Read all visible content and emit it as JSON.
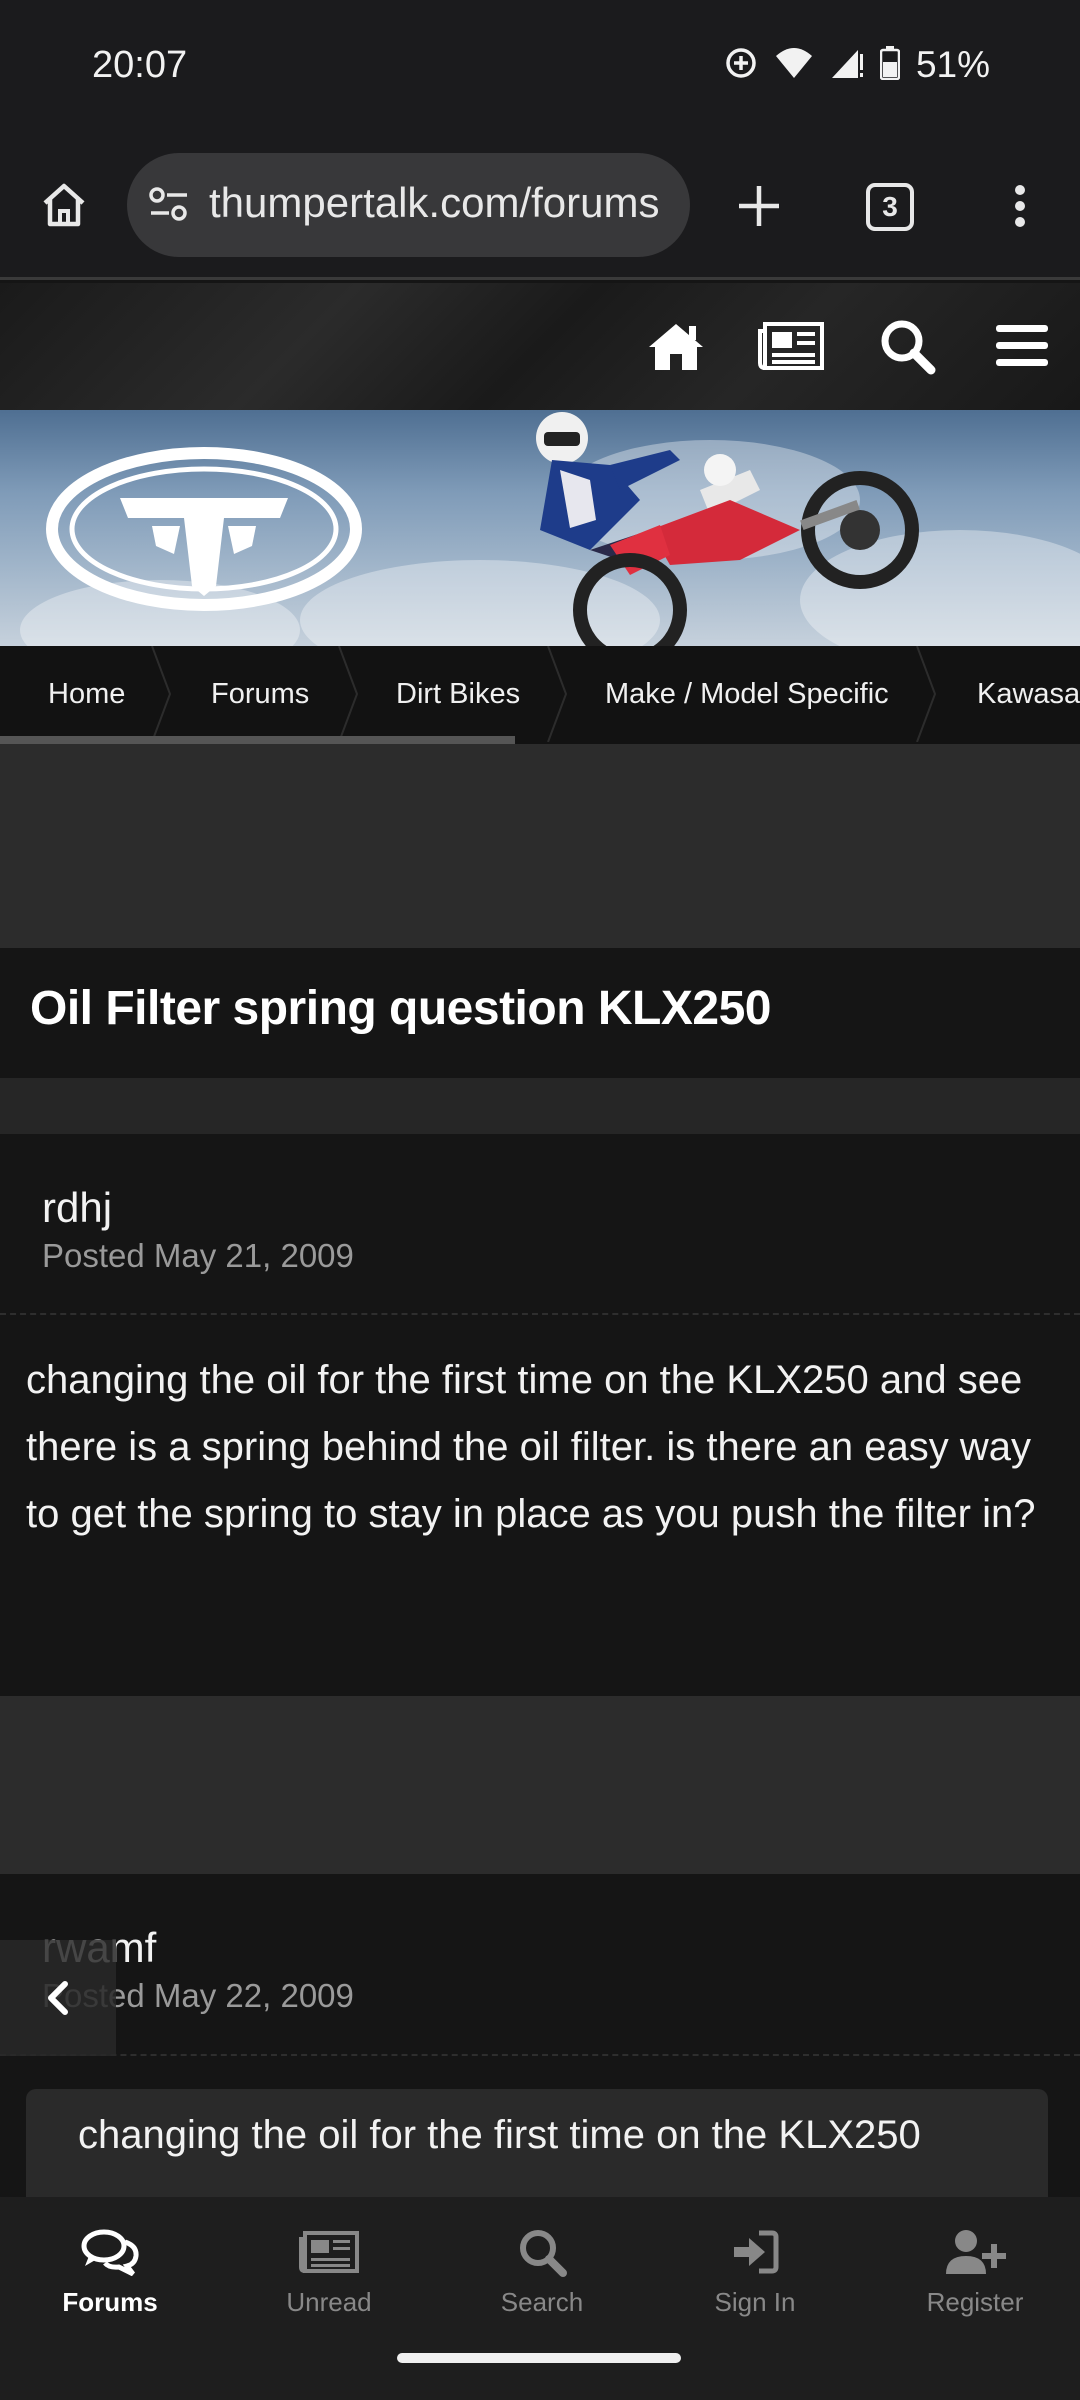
{
  "status_bar": {
    "time": "20:07",
    "battery_percent": "51%",
    "icons": [
      "data-saver-icon",
      "wifi-icon",
      "signal-icon",
      "battery-icon"
    ]
  },
  "browser": {
    "url": "thumpertalk.com/forums",
    "tab_count": "3",
    "icons": [
      "home-icon",
      "site-settings-icon",
      "plus-icon",
      "tabs-icon",
      "more-vert-icon"
    ]
  },
  "site_nav": {
    "icons": [
      "house-icon",
      "newspaper-icon",
      "search-icon",
      "hamburger-icon"
    ]
  },
  "breadcrumb": {
    "items": [
      "Home",
      "Forums",
      "Dirt Bikes",
      "Make / Model Specific",
      "Kawasaki"
    ]
  },
  "topic": {
    "title": "Oil Filter spring question KLX250"
  },
  "posts": [
    {
      "author": "rdhj",
      "date": "Posted May 21, 2009",
      "body": "changing the oil for the first time on the KLX250 and see there is a spring behind the oil filter. is there an easy way to get the spring to stay in place as you push the filter in?"
    },
    {
      "author": "rwamf",
      "date": "Posted May 22, 2009",
      "quote": "changing the oil for the first time on the KLX250"
    }
  ],
  "bottom_nav": {
    "items": [
      {
        "label": "Forums",
        "icon": "chat-bubbles-icon",
        "active": true
      },
      {
        "label": "Unread",
        "icon": "newspaper-icon",
        "active": false
      },
      {
        "label": "Search",
        "icon": "search-icon",
        "active": false
      },
      {
        "label": "Sign In",
        "icon": "sign-in-icon",
        "active": false
      },
      {
        "label": "Register",
        "icon": "user-plus-icon",
        "active": false
      }
    ]
  },
  "colors": {
    "background": "#151515",
    "panel": "#2c2c2c",
    "muted_text": "#9a9a9a",
    "url_pill": "#38383a"
  }
}
